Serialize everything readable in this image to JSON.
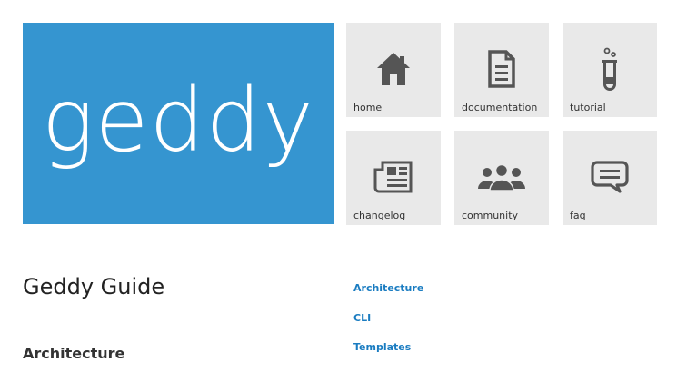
{
  "logo": {
    "text": "geddy",
    "color": "#3595d0"
  },
  "tiles": [
    {
      "label": "home",
      "icon": "home-icon"
    },
    {
      "label": "documentation",
      "icon": "document-icon"
    },
    {
      "label": "tutorial",
      "icon": "test-tube-icon"
    },
    {
      "label": "changelog",
      "icon": "newspaper-icon"
    },
    {
      "label": "community",
      "icon": "people-icon"
    },
    {
      "label": "faq",
      "icon": "speech-bubble-icon"
    }
  ],
  "guide": {
    "title": "Geddy Guide",
    "section": "Architecture"
  },
  "toc": [
    "Architecture",
    "CLI",
    "Templates"
  ],
  "colors": {
    "tile_bg": "#e9e9e9",
    "icon": "#555555",
    "link": "#1a7cc1"
  }
}
